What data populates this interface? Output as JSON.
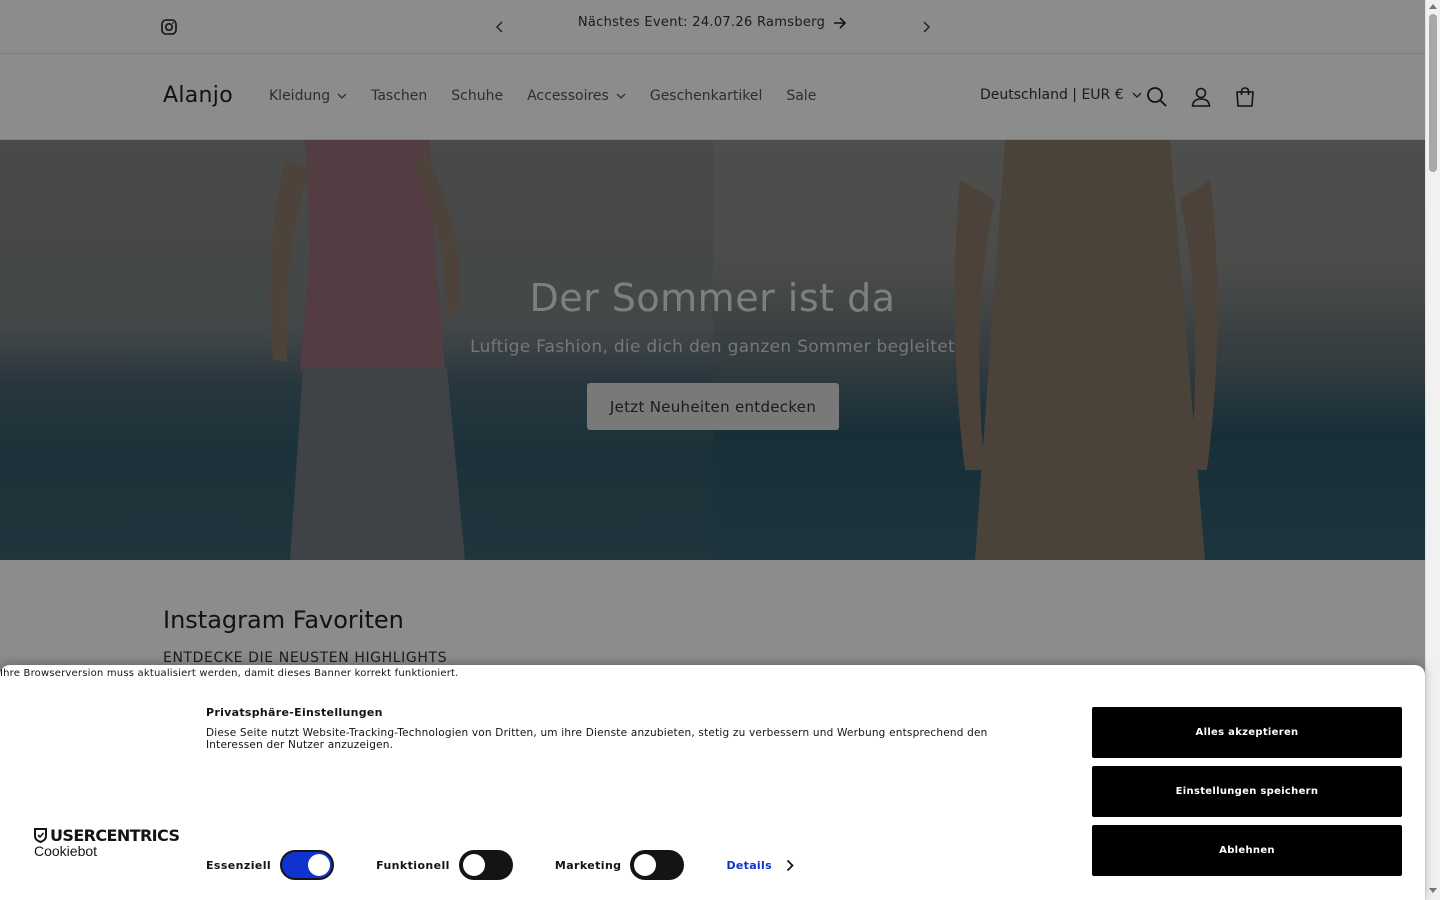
{
  "announcement": {
    "text": "Nächstes Event: 24.07.26 Ramsberg",
    "icons": [
      "instagram-icon",
      "chevron-left-icon",
      "arrow-right-icon",
      "chevron-right-icon"
    ]
  },
  "header": {
    "logo": "Alanjo",
    "nav": [
      {
        "label": "Kleidung",
        "dropdown": true
      },
      {
        "label": "Taschen",
        "dropdown": false
      },
      {
        "label": "Schuhe",
        "dropdown": false
      },
      {
        "label": "Accessoires",
        "dropdown": true
      },
      {
        "label": "Geschenkartikel",
        "dropdown": false
      },
      {
        "label": "Sale",
        "dropdown": false
      }
    ],
    "locale": "Deutschland | EUR €",
    "icons": [
      "search-icon",
      "account-icon",
      "cart-icon"
    ]
  },
  "hero": {
    "title": "Der Sommer ist da",
    "subtitle": "Luftige Fashion, die dich den ganzen Sommer begleitet",
    "cta": "Jetzt Neuheiten entdecken"
  },
  "section": {
    "title": "Instagram Favoriten",
    "subtitle": "ENTDECKE DIE NEUSTEN HIGHLIGHTS"
  },
  "cookie": {
    "warning": "Ihre Browserversion muss aktualisiert werden, damit dieses Banner korrekt funktioniert.",
    "brand_top": "USERCENTRICS",
    "brand_bottom": "Cookiebot",
    "title": "Privatsphäre-Einstellungen",
    "text": "Diese Seite nutzt Website-Tracking-Technologien von Dritten, um ihre Dienste anzubieten, stetig zu verbessern und Werbung entsprechend den Interessen der Nutzer anzuzeigen.",
    "toggles": [
      {
        "label": "Essenziell",
        "on": true
      },
      {
        "label": "Funktionell",
        "on": false
      },
      {
        "label": "Marketing",
        "on": false
      }
    ],
    "details": "Details",
    "buttons": {
      "accept_all": "Alles akzeptieren",
      "save": "Einstellungen speichern",
      "decline": "Ablehnen"
    },
    "accent_color": "#1032cf"
  }
}
